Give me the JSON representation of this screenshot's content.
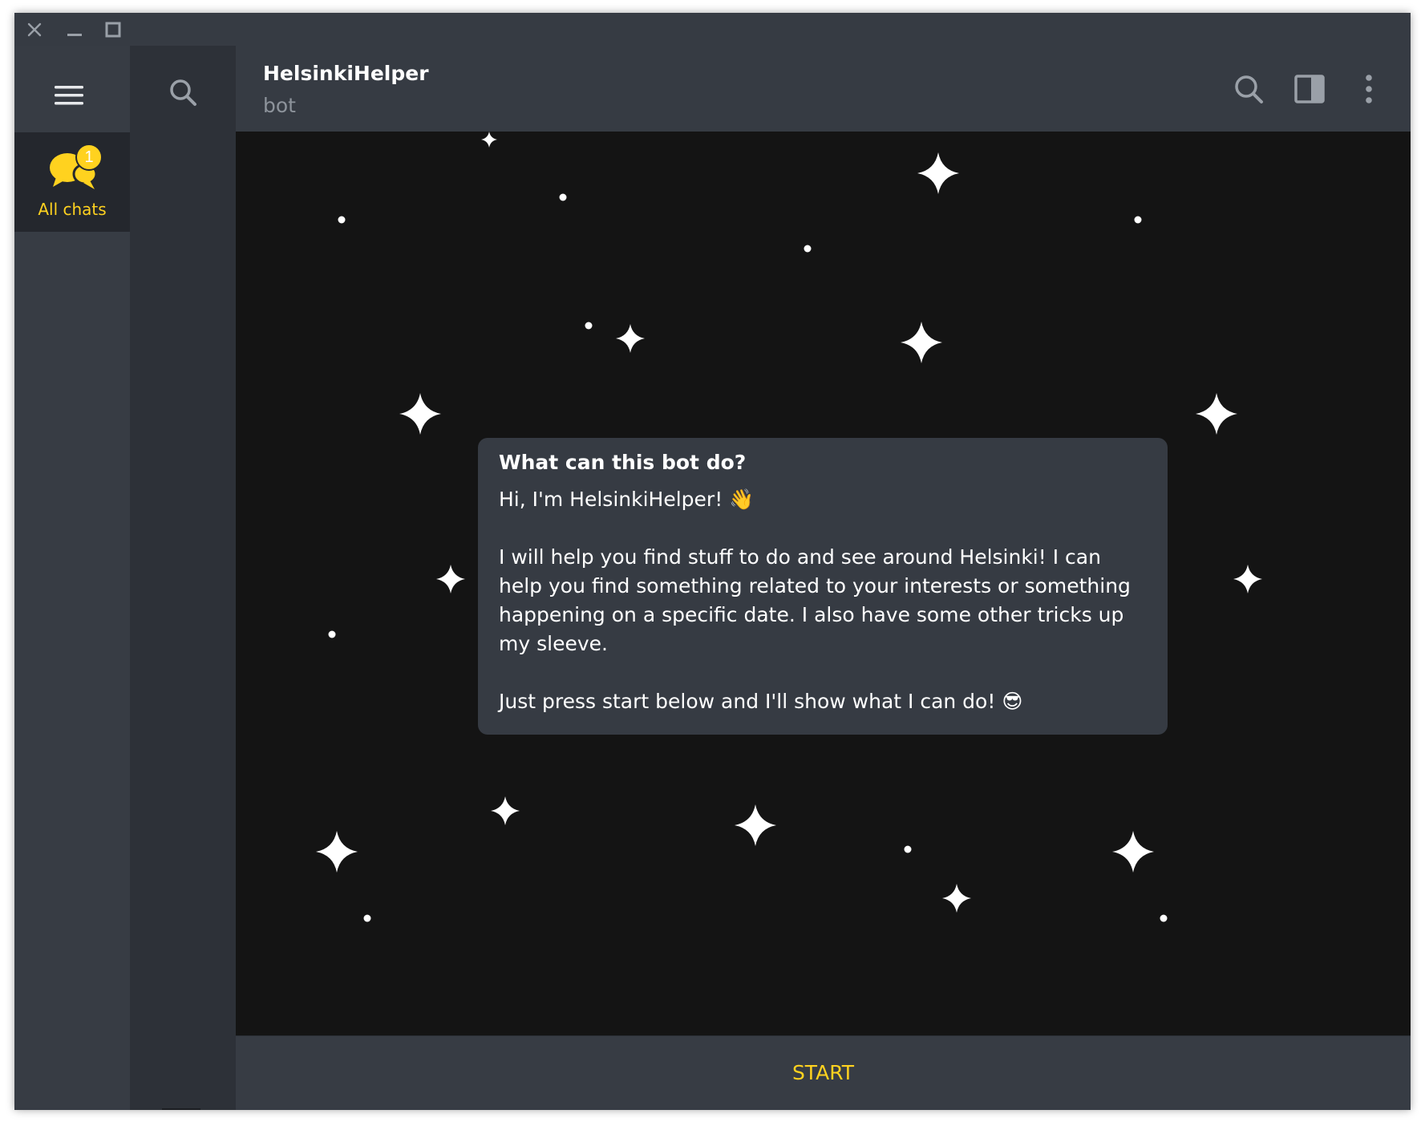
{
  "window": {
    "controls": {
      "close_icon": "close-icon",
      "minimize_icon": "minimize-icon",
      "maximize_icon": "maximize-icon"
    }
  },
  "sidebar": {
    "menu_icon": "hamburger-menu-icon",
    "folders": [
      {
        "label": "All chats",
        "badge": "1",
        "icon": "chat-bubbles-icon",
        "active": true
      }
    ]
  },
  "chat_list": {
    "search_icon": "search-icon"
  },
  "chat": {
    "title": "HelsinkiHelper",
    "status": "bot",
    "header_icons": [
      "search-icon",
      "side-panel-icon",
      "more-vertical-icon"
    ],
    "info_card": {
      "title": "What can this bot do?",
      "paragraphs": [
        "Hi, I'm HelsinkiHelper! 👋",
        "I will help you find stuff to do and see around Helsinki! I can help you find something related to your interests or something happening on a specific date. I also have some other tricks up my sleeve.",
        "Just press start below and I'll show what I can do! 😎"
      ]
    },
    "start_label": "START"
  },
  "colors": {
    "accent": "#ffd21f",
    "window_bg": "#2a2e35",
    "header_bg": "#363b43",
    "chat_bg": "#141414",
    "card_bg": "#363b43",
    "text": "#ffffff",
    "muted_text": "#8d939b"
  }
}
